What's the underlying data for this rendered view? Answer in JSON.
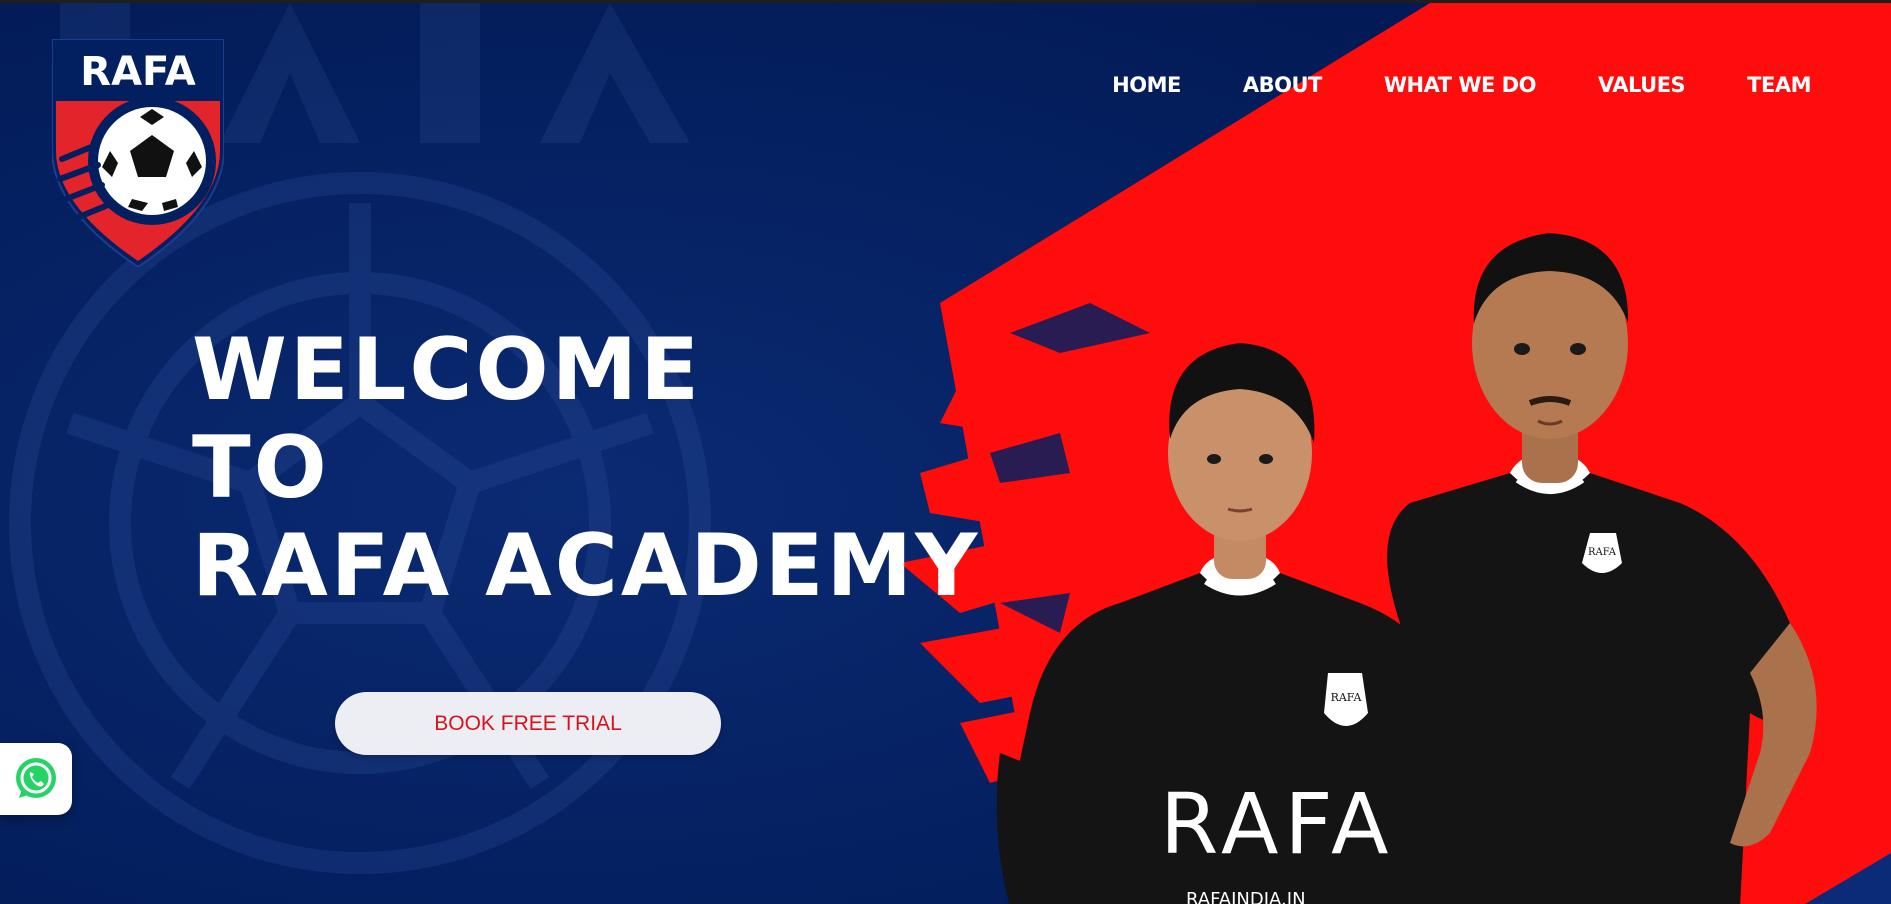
{
  "brand": {
    "logo_text": "RAFA",
    "colors": {
      "navy": "#02205f",
      "red": "#ff0c0c",
      "white": "#ffffff"
    }
  },
  "nav": {
    "items": [
      {
        "label": "HOME"
      },
      {
        "label": "ABOUT"
      },
      {
        "label": "WHAT WE DO"
      },
      {
        "label": "VALUES"
      },
      {
        "label": "TEAM"
      }
    ]
  },
  "hero": {
    "headline_line1": "WELCOME",
    "headline_line2": "TO",
    "headline_line3": "RAFA ACADEMY",
    "cta_label": "BOOK FREE TRIAL"
  },
  "jerseys": {
    "crest_letters": "RAFA",
    "chest_text": "RAFA",
    "url_text": "RAFAINDIA.IN"
  },
  "floating": {
    "whatsapp_icon": "whatsapp-icon"
  }
}
